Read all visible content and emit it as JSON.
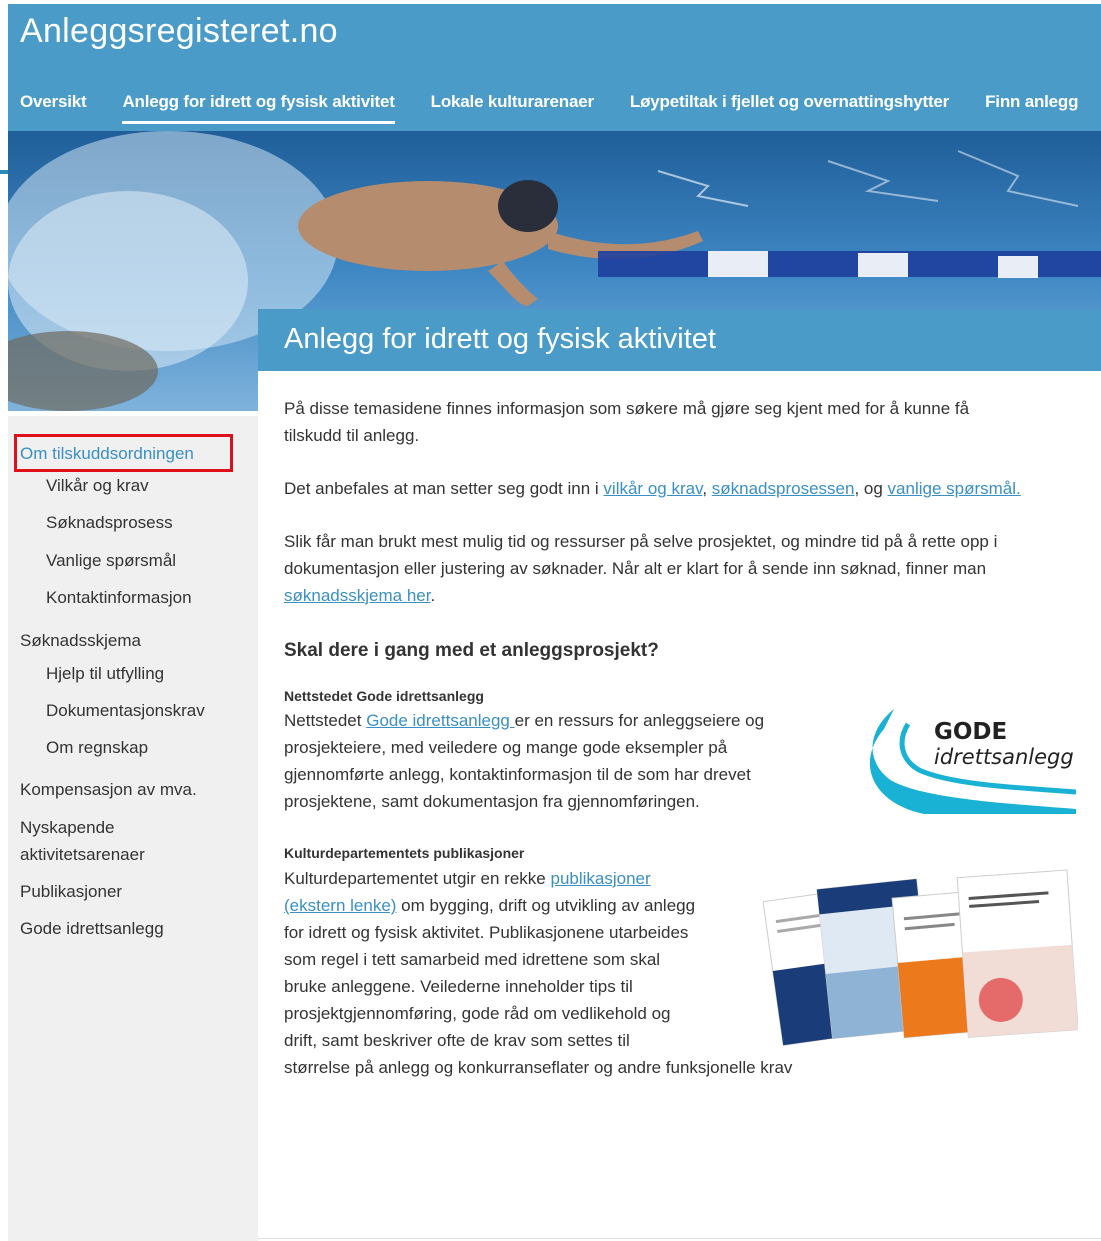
{
  "header": {
    "site_title": "Anleggsregisteret.no",
    "nav": [
      {
        "label": "Oversikt"
      },
      {
        "label": "Anlegg for idrett og fysisk aktivitet"
      },
      {
        "label": "Lokale kulturarenaer"
      },
      {
        "label": "Løypetiltak i fjellet og overnattingshytter"
      },
      {
        "label": "Finn anlegg"
      }
    ],
    "accent_color": "#4a9bc7"
  },
  "sidebar": {
    "items": [
      {
        "label": "Om tilskuddsordningen"
      },
      {
        "label": "Vilkår og krav"
      },
      {
        "label": "Søknadsprosess"
      },
      {
        "label": "Vanlige spørsmål"
      },
      {
        "label": "Kontaktinformasjon"
      },
      {
        "label": "Søknadsskjema"
      },
      {
        "label": "Hjelp til utfylling"
      },
      {
        "label": "Dokumentasjonskrav"
      },
      {
        "label": "Om regnskap"
      },
      {
        "label": "Kompensasjon av mva."
      },
      {
        "label": "Nyskapende"
      },
      {
        "label": "aktivitetsarenaer"
      },
      {
        "label": "Publikasjoner"
      },
      {
        "label": "Gode idrettsanlegg"
      }
    ],
    "highlight_color": "#e0101a"
  },
  "content": {
    "title": "Anlegg for idrett og fysisk aktivitet",
    "intro_line1": "På disse temasidene finnes informasjon som søkere må gjøre seg kjent med for å kunne få",
    "intro_line2": "tilskudd til anlegg.",
    "recommend_prefix": "Det anbefales at man setter seg godt inn i ",
    "link_vilkar": "vilkår og krav",
    "sep1": ", ",
    "link_soknad": "søknadsprosessen",
    "sep2": ", og ",
    "link_vanlige": "vanlige spørsmål.",
    "p3_line1": "Slik får man brukt mest mulig tid og ressurser på selve prosjektet, og mindre tid på å rette opp i",
    "p3_line2": "dokumentasjon eller justering av søknader. Når alt er klart for å sende inn søknad, finner man",
    "link_skjema": "søknadsskjema her",
    "p3_end": ".",
    "section_heading": "Skal dere i gang med et anleggsprosjekt?",
    "gode": {
      "heading": "Nettstedet Gode idrettsanlegg",
      "l1_prefix": "Nettstedet ",
      "l1_link": "Gode idrettsanlegg ",
      "l1_suffix": "er en ressurs for anleggseiere og",
      "l2": "prosjekteiere, med veiledere og mange gode eksempler på",
      "l3": "gjennomførte anlegg, kontaktinformasjon til de som har drevet",
      "l4": "prosjektene, samt dokumentasjon fra gjennomføringen.",
      "logo_text_1": "GODE",
      "logo_text_2": "idrettsanlegg"
    },
    "kud": {
      "heading": "Kulturdepartementets publikasjoner",
      "l1_prefix": "Kulturdepartementet utgir en rekke ",
      "l1_link": "publikasjoner",
      "l2_link": "(ekstern lenke)",
      "l2_suffix": " om bygging, drift og utvikling av anlegg",
      "l3": "for idrett og fysisk aktivitet. Publikasjonene utarbeides",
      "l4": "som regel i tett samarbeid med idrettene som skal",
      "l5": "bruke anleggene. Veilederne inneholder tips til",
      "l6": "prosjektgjennomføring, gode råd om vedlikehold og",
      "l7": "drift, samt beskriver ofte de krav som settes til",
      "l8": "størrelse på anlegg og konkurranseflater og andre funksjonelle krav"
    }
  }
}
